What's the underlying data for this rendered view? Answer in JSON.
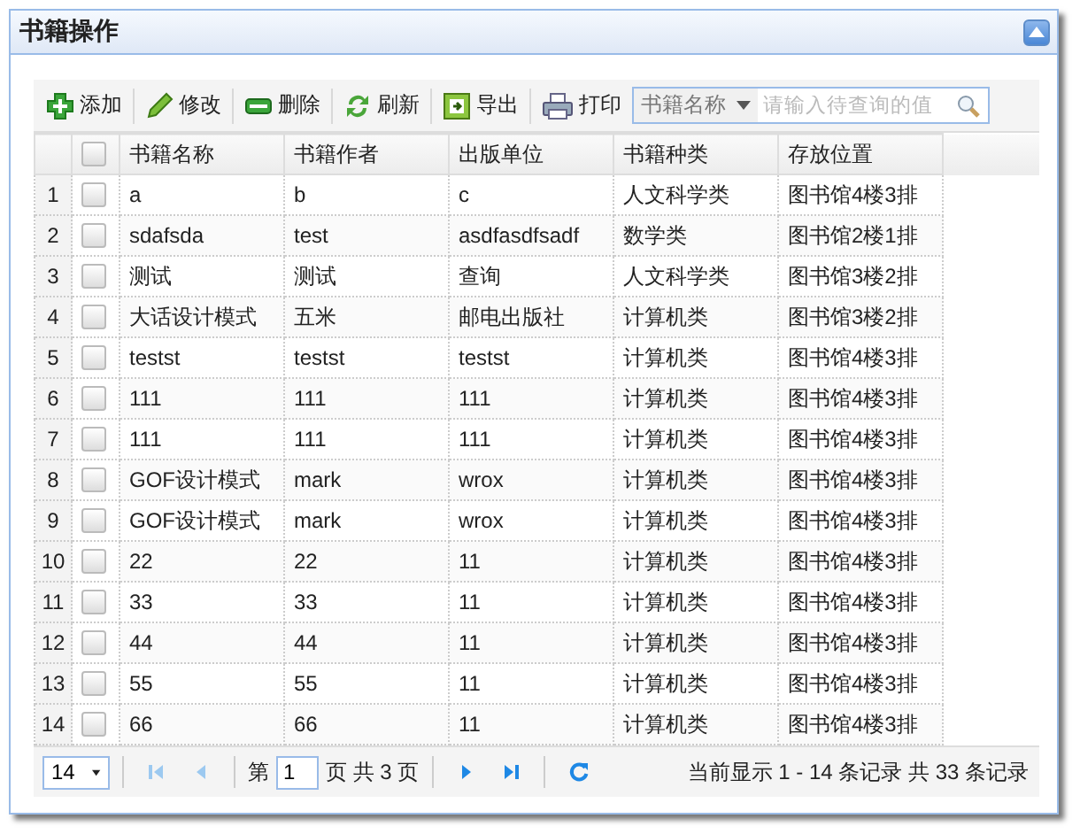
{
  "panel": {
    "title": "书籍操作",
    "collapsed": false
  },
  "toolbar": [
    {
      "kind": "add",
      "label": "添加"
    },
    {
      "kind": "edit",
      "label": "修改"
    },
    {
      "kind": "delete",
      "label": "删除"
    },
    {
      "kind": "refresh",
      "label": "刷新"
    },
    {
      "kind": "export",
      "label": "导出"
    },
    {
      "kind": "print",
      "label": "打印"
    }
  ],
  "search": {
    "field": "书籍名称",
    "placeholder": "请输入待查询的值"
  },
  "table": {
    "columns": [
      "书籍名称",
      "书籍作者",
      "出版单位",
      "书籍种类",
      "存放位置"
    ],
    "all_checked": false,
    "rows": [
      {
        "n": "1",
        "checked": false,
        "cells": [
          "a",
          "b",
          "c",
          "人文科学类",
          "图书馆4楼3排"
        ]
      },
      {
        "n": "2",
        "checked": false,
        "cells": [
          "sdafsda",
          "test",
          "asdfasdfsadf",
          "数学类",
          "图书馆2楼1排"
        ]
      },
      {
        "n": "3",
        "checked": false,
        "cells": [
          "测试",
          "测试",
          "查询",
          "人文科学类",
          "图书馆3楼2排"
        ]
      },
      {
        "n": "4",
        "checked": false,
        "cells": [
          "大话设计模式",
          "五米",
          "邮电出版社",
          "计算机类",
          "图书馆3楼2排"
        ]
      },
      {
        "n": "5",
        "checked": false,
        "cells": [
          "testst",
          "testst",
          "testst",
          "计算机类",
          "图书馆4楼3排"
        ]
      },
      {
        "n": "6",
        "checked": false,
        "cells": [
          "111",
          "111",
          "111",
          "计算机类",
          "图书馆4楼3排"
        ]
      },
      {
        "n": "7",
        "checked": false,
        "cells": [
          "111",
          "111",
          "111",
          "计算机类",
          "图书馆4楼3排"
        ]
      },
      {
        "n": "8",
        "checked": false,
        "cells": [
          "GOF设计模式",
          "mark",
          "wrox",
          "计算机类",
          "图书馆4楼3排"
        ]
      },
      {
        "n": "9",
        "checked": false,
        "cells": [
          "GOF设计模式",
          "mark",
          "wrox",
          "计算机类",
          "图书馆4楼3排"
        ]
      },
      {
        "n": "10",
        "checked": false,
        "cells": [
          "22",
          "22",
          "11",
          "计算机类",
          "图书馆4楼3排"
        ]
      },
      {
        "n": "11",
        "checked": false,
        "cells": [
          "33",
          "33",
          "11",
          "计算机类",
          "图书馆4楼3排"
        ]
      },
      {
        "n": "12",
        "checked": false,
        "cells": [
          "44",
          "44",
          "11",
          "计算机类",
          "图书馆4楼3排"
        ]
      },
      {
        "n": "13",
        "checked": false,
        "cells": [
          "55",
          "55",
          "11",
          "计算机类",
          "图书馆4楼3排"
        ]
      },
      {
        "n": "14",
        "checked": false,
        "cells": [
          "66",
          "66",
          "11",
          "计算机类",
          "图书馆4楼3排"
        ]
      }
    ]
  },
  "pager": {
    "page_size": "14",
    "page_label": "第",
    "page": "1",
    "page_total": "页 共 3 页",
    "first_disabled": true,
    "prev_disabled": true,
    "info": "当前显示 1 - 14 条记录 共 33 条记录"
  }
}
